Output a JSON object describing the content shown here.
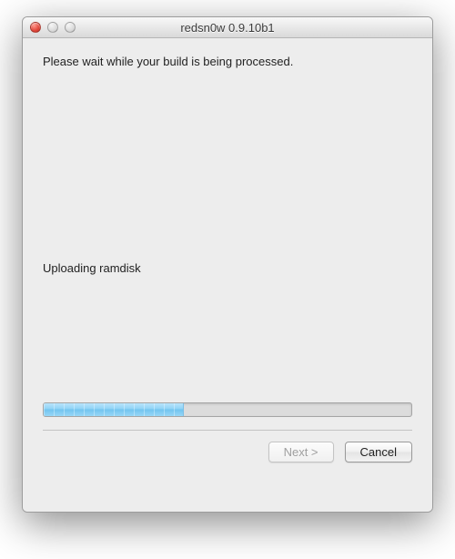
{
  "window": {
    "title": "redsn0w 0.9.10b1"
  },
  "content": {
    "instruction": "Please wait while your build is being processed.",
    "status": "Uploading ramdisk"
  },
  "progress": {
    "percent": 38
  },
  "buttons": {
    "next": "Next >",
    "cancel": "Cancel",
    "next_enabled": false
  }
}
